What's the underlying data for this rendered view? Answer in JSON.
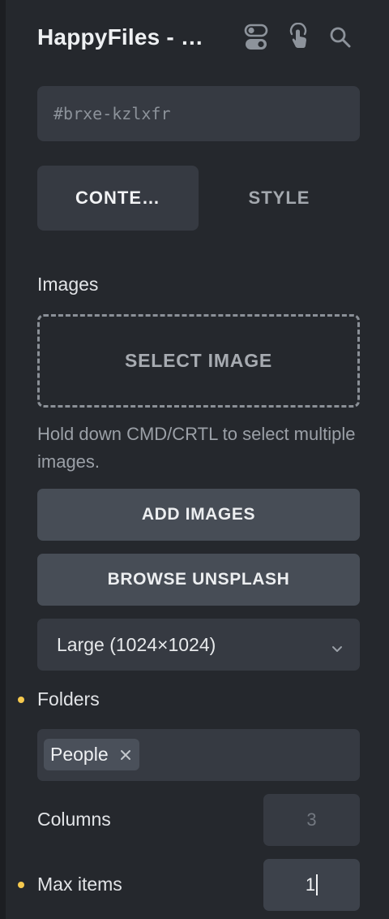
{
  "header": {
    "title": "HappyFiles - …",
    "icons": [
      "toggle-icon",
      "pointer-hand-icon",
      "search-icon"
    ]
  },
  "element_id": {
    "value": "#brxe-kzlxfr"
  },
  "tabs": [
    {
      "label": "CONTE…",
      "active": true
    },
    {
      "label": "STYLE",
      "active": false
    }
  ],
  "images": {
    "label": "Images",
    "select_label": "SELECT IMAGE",
    "hint": "Hold down CMD/CRTL to select multiple images.",
    "add_label": "ADD IMAGES",
    "unsplash_label": "BROWSE UNSPLASH",
    "size_value": "Large (1024×1024)"
  },
  "folders": {
    "label": "Folders",
    "modified": true,
    "tags": [
      "People"
    ]
  },
  "columns": {
    "label": "Columns",
    "placeholder": "3"
  },
  "max_items": {
    "label": "Max items",
    "modified": true,
    "value": "1"
  },
  "colors": {
    "background": "#25282d",
    "field": "#363a42",
    "button": "#474d56",
    "modified_dot": "#f6c94e"
  }
}
